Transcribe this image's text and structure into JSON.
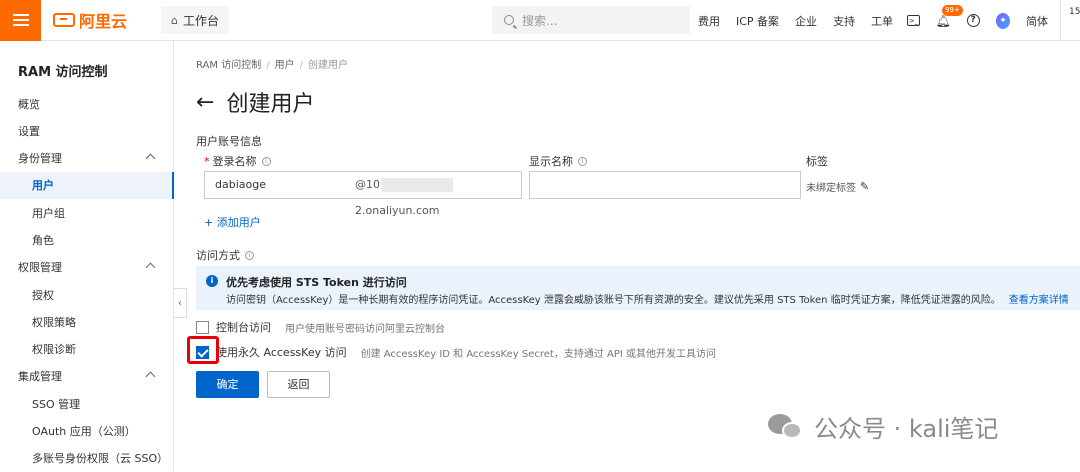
{
  "header": {
    "logo_text": "阿里云",
    "workbench_label": "工作台",
    "search_placeholder": "搜索...",
    "nav": [
      "费用",
      "ICP 备案",
      "企业",
      "支持",
      "工单"
    ],
    "notification_count": "99+",
    "avatar_initial": "",
    "language": "简体",
    "corner_text": "15"
  },
  "sidebar": {
    "title": "RAM 访问控制",
    "items": [
      {
        "label": "概览"
      },
      {
        "label": "设置"
      },
      {
        "label": "身份管理"
      },
      {
        "label": "用户"
      },
      {
        "label": "用户组"
      },
      {
        "label": "角色"
      },
      {
        "label": "权限管理"
      },
      {
        "label": "授权"
      },
      {
        "label": "权限策略"
      },
      {
        "label": "权限诊断"
      },
      {
        "label": "集成管理"
      },
      {
        "label": "SSO 管理"
      },
      {
        "label": "OAuth 应用（公测）"
      },
      {
        "label": "多账号身份权限（云 SSO）"
      }
    ]
  },
  "main": {
    "breadcrumb": [
      "RAM 访问控制",
      "用户",
      "创建用户"
    ],
    "title": "创建用户",
    "section_label": "用户账号信息",
    "login_name_label": "登录名称",
    "display_name_label": "显示名称",
    "tag_label": "标签",
    "login_name_value": "dabiaoge",
    "login_name_suffix_start": "@10",
    "login_name_suffix_end": "2.onaliyun.com",
    "display_name_value": "",
    "tag_value": "未绑定标签",
    "add_user_label": "+ 添加用户",
    "access_label": "访问方式",
    "notice_title": "优先考虑使用 STS Token 进行访问",
    "notice_desc": "访问密钥（AccessKey）是一种长期有效的程序访问凭证。AccessKey 泄露会威胁该账号下所有资源的安全。建议优先采用 STS Token 临时凭证方案，降低凭证泄露的风险。",
    "notice_link": "查看方案详情",
    "options": [
      {
        "label": "控制台访问",
        "desc": "用户使用账号密码访问阿里云控制台",
        "checked": false
      },
      {
        "label": "使用永久 AccessKey 访问",
        "desc": "创建 AccessKey ID 和 AccessKey Secret，支持通过 API 或其他开发工具访问",
        "checked": true
      }
    ],
    "confirm_label": "确定",
    "back_label": "返回"
  },
  "watermark": "公众号 · kali笔记"
}
